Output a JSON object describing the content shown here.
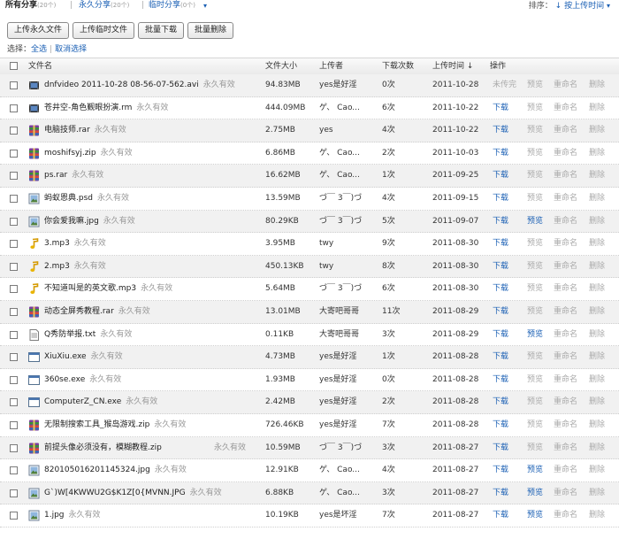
{
  "tabs": [
    {
      "label": "所有分享",
      "count": "(20个)",
      "active": true
    },
    {
      "label": "永久分享",
      "count": "(20个)",
      "active": false
    },
    {
      "label": "临时分享",
      "count": "(0个)",
      "active": false
    }
  ],
  "sort": {
    "label": "排序：",
    "value": "按上传时间"
  },
  "toolbar": {
    "upload_permanent": "上传永久文件",
    "upload_temp": "上传临时文件",
    "batch_download": "批量下载",
    "batch_delete": "批量删除"
  },
  "select": {
    "label": "选择：",
    "all": "全选",
    "cancel": "取消选择"
  },
  "columns": {
    "name": "文件名",
    "size": "文件大小",
    "uploader": "上传者",
    "downloads": "下载次数",
    "time": "上传时间",
    "actions": "操作"
  },
  "actions": {
    "download": "下载",
    "preview": "预览",
    "rename": "重命名",
    "delete": "删除",
    "unfinished": "未传完"
  },
  "colors": {
    "link": "#1a5fb4",
    "muted": "#aaaaaa",
    "row_alt": "#f1f1f1"
  },
  "files": [
    {
      "name": "dnfvideo 2011-10-28 08-56-07-562.avi",
      "validity": "永久有效",
      "size": "94.83MB",
      "uploader": "yes是好淫",
      "downloads": "0次",
      "time": "2011-10-28",
      "icon": "video-icon",
      "status": "incomplete",
      "preview": false
    },
    {
      "name": "苍井空-角色觐眼扮演.rm",
      "validity": "永久有效",
      "size": "444.09MB",
      "uploader": "ゲ、     Cao...",
      "downloads": "6次",
      "time": "2011-10-22",
      "icon": "video-icon",
      "status": "ok",
      "preview": false
    },
    {
      "name": "电脑技师.rar",
      "validity": "永久有效",
      "size": "2.75MB",
      "uploader": "yes",
      "downloads": "4次",
      "time": "2011-10-22",
      "icon": "archive-icon",
      "status": "ok",
      "preview": false
    },
    {
      "name": "moshifsyj.zip",
      "validity": "永久有效",
      "size": "6.86MB",
      "uploader": "ゲ、     Cao...",
      "downloads": "2次",
      "time": "2011-10-03",
      "icon": "archive-icon",
      "status": "ok",
      "preview": false
    },
    {
      "name": "ps.rar",
      "validity": "永久有效",
      "size": "16.62MB",
      "uploader": "ゲ、     Cao...",
      "downloads": "1次",
      "time": "2011-09-25",
      "icon": "archive-icon",
      "status": "ok",
      "preview": false
    },
    {
      "name": "蚂蚁恩典.psd",
      "validity": "永久有效",
      "size": "13.59MB",
      "uploader": "づ￣ 3￣)づ",
      "downloads": "4次",
      "time": "2011-09-15",
      "icon": "image-icon",
      "status": "ok",
      "preview": false
    },
    {
      "name": "你会爱我嘛.jpg",
      "validity": "永久有效",
      "size": "80.29KB",
      "uploader": "づ￣ 3￣)づ",
      "downloads": "5次",
      "time": "2011-09-07",
      "icon": "image-icon",
      "status": "ok",
      "preview": true
    },
    {
      "name": "3.mp3",
      "validity": "永久有效",
      "size": "3.95MB",
      "uploader": "twy",
      "downloads": "9次",
      "time": "2011-08-30",
      "icon": "music-icon",
      "status": "ok",
      "preview": false
    },
    {
      "name": "2.mp3",
      "validity": "永久有效",
      "size": "450.13KB",
      "uploader": "twy",
      "downloads": "8次",
      "time": "2011-08-30",
      "icon": "music-icon",
      "status": "ok",
      "preview": false
    },
    {
      "name": "不知道叫是的英文歌.mp3",
      "validity": "永久有效",
      "size": "5.64MB",
      "uploader": "づ￣ 3￣)づ",
      "downloads": "6次",
      "time": "2011-08-30",
      "icon": "music-icon",
      "status": "ok",
      "preview": false
    },
    {
      "name": "动态全屏秀教程.rar",
      "validity": "永久有效",
      "size": "13.01MB",
      "uploader": "大寄吧哥哥",
      "downloads": "11次",
      "time": "2011-08-29",
      "icon": "archive-icon",
      "status": "ok",
      "preview": false
    },
    {
      "name": "Q秀防举报.txt",
      "validity": "永久有效",
      "size": "0.11KB",
      "uploader": "大寄吧哥哥",
      "downloads": "3次",
      "time": "2011-08-29",
      "icon": "text-icon",
      "status": "ok",
      "preview": true
    },
    {
      "name": "XiuXiu.exe",
      "validity": "永久有效",
      "size": "4.73MB",
      "uploader": "yes是好淫",
      "downloads": "1次",
      "time": "2011-08-28",
      "icon": "exe-icon",
      "status": "ok",
      "preview": false
    },
    {
      "name": "360se.exe",
      "validity": "永久有效",
      "size": "1.93MB",
      "uploader": "yes是好淫",
      "downloads": "0次",
      "time": "2011-08-28",
      "icon": "exe-icon",
      "status": "ok",
      "preview": false
    },
    {
      "name": "ComputerZ_CN.exe",
      "validity": "永久有效",
      "size": "2.42MB",
      "uploader": "yes是好淫",
      "downloads": "2次",
      "time": "2011-08-28",
      "icon": "exe-icon",
      "status": "ok",
      "preview": false
    },
    {
      "name": "无限制搜索工具_猴岛游戏.zip",
      "validity": "永久有效",
      "size": "726.46KB",
      "uploader": "yes是好淫",
      "downloads": "7次",
      "time": "2011-08-28",
      "icon": "archive-icon",
      "status": "ok",
      "preview": false
    },
    {
      "name": "前提头像必须没有，模糊教程.zip",
      "validity": "永久有效",
      "size": "10.59MB",
      "uploader": "づ￣ 3￣)づ",
      "downloads": "3次",
      "time": "2011-08-27",
      "icon": "archive-icon",
      "status": "ok",
      "preview": false,
      "validity_column": true
    },
    {
      "name": "820105016201145324.jpg",
      "validity": "永久有效",
      "size": "12.91KB",
      "uploader": "ゲ、     Cao...",
      "downloads": "4次",
      "time": "2011-08-27",
      "icon": "image-icon",
      "status": "ok",
      "preview": true
    },
    {
      "name": "G`)W[4KWWU2G$K1Z[0{MVNN.JPG",
      "validity": "永久有效",
      "size": "6.88KB",
      "uploader": "ゲ、     Cao...",
      "downloads": "3次",
      "time": "2011-08-27",
      "icon": "image-icon",
      "status": "ok",
      "preview": true
    },
    {
      "name": "1.jpg",
      "validity": "永久有效",
      "size": "10.19KB",
      "uploader": "yes是坏淫",
      "downloads": "7次",
      "time": "2011-08-27",
      "icon": "image-icon",
      "status": "ok",
      "preview": true
    }
  ]
}
